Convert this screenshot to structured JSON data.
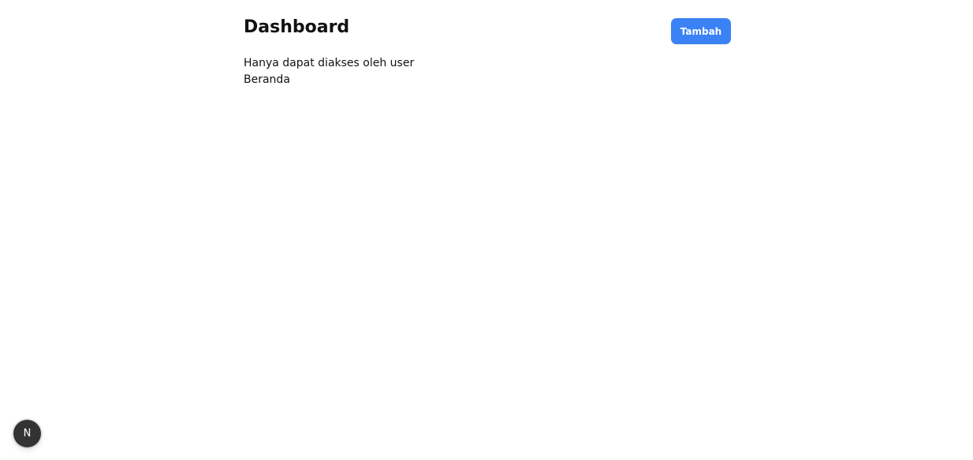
{
  "header": {
    "title": "Dashboard",
    "add_button_label": "Tambah"
  },
  "main": {
    "lines": [
      "Hanya dapat diakses oleh user",
      "Beranda"
    ]
  },
  "dev_indicator": {
    "icon_label": "N",
    "icon_name": "nextjs-icon",
    "background_color": "#333333"
  },
  "colors": {
    "accent": "#3b82f6",
    "text": "#111111",
    "background": "#ffffff"
  }
}
